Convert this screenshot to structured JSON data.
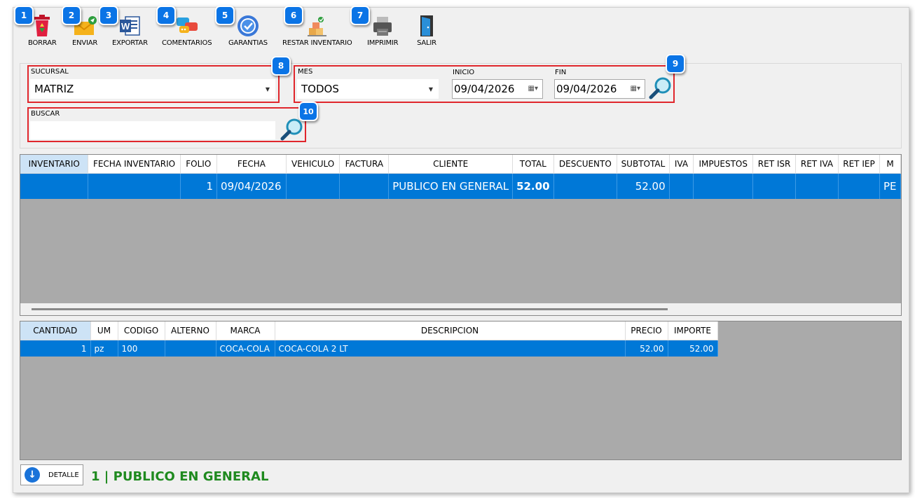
{
  "toolbar": {
    "borrar": "BORRAR",
    "enviar": "ENVIAR",
    "exportar": "EXPORTAR",
    "comentarios": "COMENTARIOS",
    "garantias": "GARANTIAS",
    "restar_inventario": "RESTAR INVENTARIO",
    "imprimir": "IMPRIMIR",
    "salir": "SALIR"
  },
  "badges": [
    "1",
    "2",
    "3",
    "4",
    "5",
    "6",
    "7",
    "8",
    "9",
    "10"
  ],
  "filters": {
    "sucursal_label": "SUCURSAL",
    "sucursal_value": "MATRIZ",
    "mes_label": "MES",
    "mes_value": "TODOS",
    "inicio_label": "INICIO",
    "inicio_value": "09/04/2026",
    "fin_label": "FIN",
    "fin_value": "09/04/2026",
    "buscar_label": "BUSCAR",
    "buscar_value": ""
  },
  "grid1": {
    "columns": [
      "INVENTARIO",
      "FECHA INVENTARIO",
      "FOLIO",
      "FECHA",
      "VEHICULO",
      "FACTURA",
      "CLIENTE",
      "TOTAL",
      "DESCUENTO",
      "SUBTOTAL",
      "IVA",
      "IMPUESTOS",
      "RET ISR",
      "RET IVA",
      "RET IEP",
      "M"
    ],
    "rows": [
      [
        "",
        "",
        "1",
        "09/04/2026",
        "",
        "",
        "PUBLICO EN GENERAL",
        "52.00",
        "",
        "52.00",
        "",
        "",
        "",
        "",
        "",
        "PE"
      ]
    ]
  },
  "grid2": {
    "columns": [
      "CANTIDAD",
      "UM",
      "CODIGO",
      "ALTERNO",
      "MARCA",
      "DESCRIPCION",
      "PRECIO",
      "IMPORTE"
    ],
    "rows": [
      [
        "1",
        "pz",
        "100",
        "",
        "COCA-COLA",
        "COCA-COLA 2 LT",
        "52.00",
        "52.00"
      ]
    ]
  },
  "footer": {
    "detalle_label": "DETALLE",
    "status": "1 | PUBLICO EN GENERAL"
  },
  "colors": {
    "accent": "#0078d7",
    "badge": "#0a74e6",
    "highlight_border": "#e0262c",
    "status_text": "#1f8a1f"
  }
}
